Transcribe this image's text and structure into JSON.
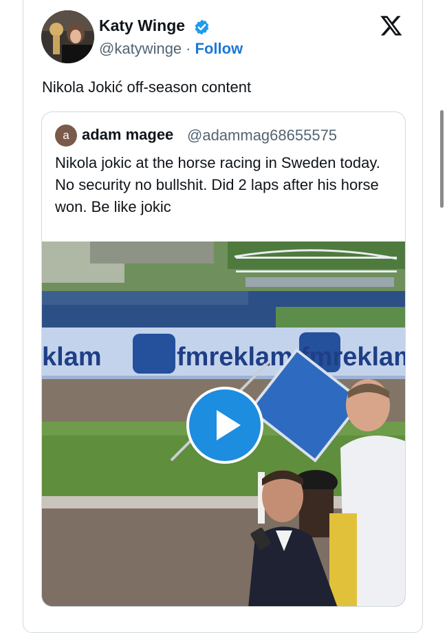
{
  "tweet": {
    "author_name": "Katy Winge",
    "handle": "@katywinge",
    "separator": "·",
    "follow_label": "Follow",
    "text": "Nikola Jokić off-season content"
  },
  "quoted_tweet": {
    "avatar_initial": "a",
    "author_name": "adam magee",
    "handle": "@adammag68655575",
    "text": "Nikola jokic at the horse racing in Sweden today. No security no bullshit. Did 2 laps after his horse won. Be like jokic"
  },
  "video": {
    "banner_text": "fmreklam",
    "banner_left_fragment": "klam"
  },
  "colors": {
    "accent": "#1d78d6",
    "play_button": "#1d8de0",
    "verified_badge": "#1d9bf0"
  },
  "icons": {
    "verified": "verified-badge-icon",
    "platform": "x-logo-icon",
    "play": "play-icon"
  }
}
